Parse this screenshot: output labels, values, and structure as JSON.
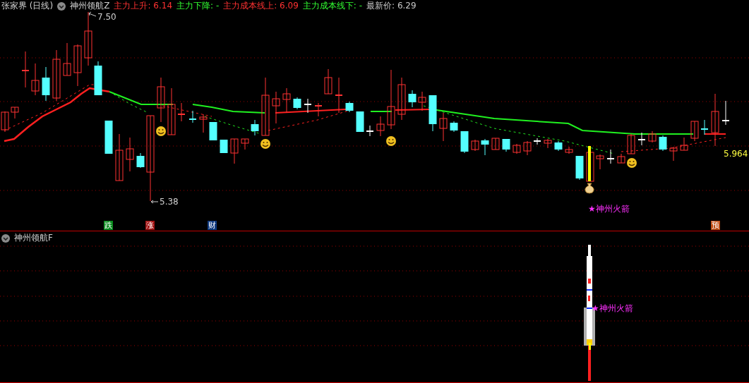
{
  "header": {
    "symbol": "张家界 (日线)",
    "indicator": "神州领航Z",
    "readouts": [
      {
        "label": "主力上升:",
        "value": "6.14",
        "kind": "up"
      },
      {
        "label": "主力下降:",
        "value": "-",
        "kind": "down"
      },
      {
        "label": "主力成本线上:",
        "value": "6.09",
        "kind": "up"
      },
      {
        "label": "主力成本线下:",
        "value": "-",
        "kind": "down"
      },
      {
        "label": "最新价:",
        "value": "6.29",
        "kind": "price"
      }
    ]
  },
  "price_chart": {
    "high_label": "7.50",
    "low_label": "5.38",
    "right_label": "5.964",
    "signal_label": "★神州火箭",
    "markers": [
      {
        "text": "跌",
        "color": "#0a8a1e"
      },
      {
        "text": "涨",
        "color": "#a01010"
      },
      {
        "text": "财",
        "color": "#103a80"
      },
      {
        "text": "预",
        "color": "#c04a10"
      }
    ]
  },
  "lower_panel": {
    "title": "神州领航F",
    "signal_label": "★神州火箭"
  }
}
